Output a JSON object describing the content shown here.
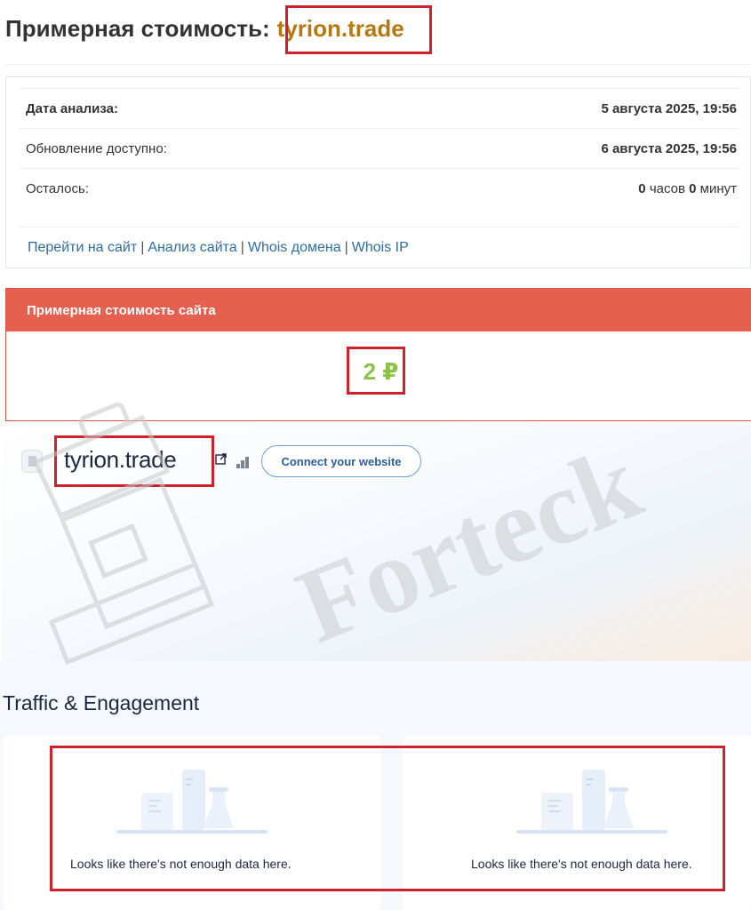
{
  "header": {
    "label": "Примерная стоимость:",
    "domain": "tyrion.trade"
  },
  "info": {
    "rows": [
      {
        "key": "Дата анализа:",
        "value": "5 августа 2025, 19:56"
      },
      {
        "key": "Обновление доступно:",
        "value": "6 августа 2025, 19:56"
      }
    ],
    "remaining": {
      "key": "Осталось:",
      "hours": "0",
      "hours_unit": "часов",
      "minutes": "0",
      "minutes_unit": "минут"
    },
    "links": [
      {
        "label": "Перейти на сайт"
      },
      {
        "label": "Анализ сайта"
      },
      {
        "label": "Whois домена"
      },
      {
        "label": "Whois IP"
      }
    ],
    "separator": "|"
  },
  "cost": {
    "title": "Примерная стоимость сайта",
    "value": "2 ₽"
  },
  "site": {
    "domain": "tyrion.trade",
    "connect_label": "Connect your website"
  },
  "traffic": {
    "title": "Traffic & Engagement",
    "cards": [
      {
        "message": "Looks like there's not enough data here."
      },
      {
        "message": "Looks like there's not enough data here."
      }
    ]
  },
  "watermark": {
    "text": "Forteck"
  },
  "colors": {
    "domain_accent": "#b8770f",
    "cost_header": "#e6604f",
    "cost_value": "#8bc34a",
    "link": "#2e6da4",
    "highlight_box": "#d0202e"
  }
}
